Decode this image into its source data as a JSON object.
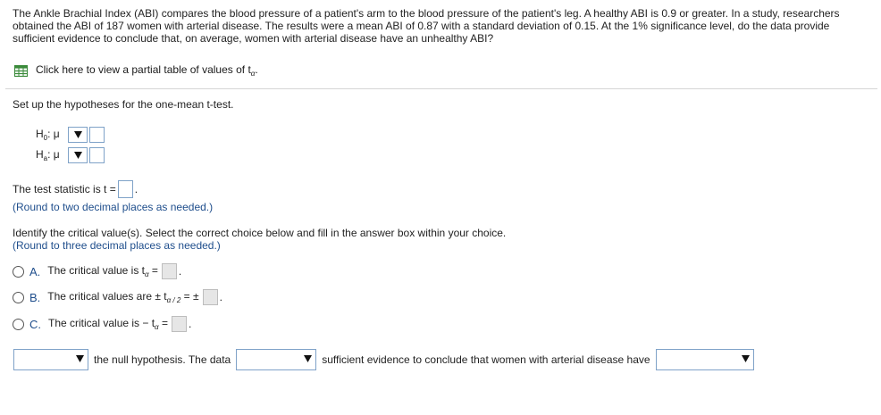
{
  "problem": {
    "text": "The Ankle Brachial Index (ABI) compares the blood pressure of a patient's arm to the blood pressure of the patient's leg. A healthy ABI is 0.9 or greater. In a study, researchers obtained the ABI of 187 women with arterial disease. The results were a mean ABI of 0.87 with a standard deviation of 0.15. At the 1% significance level, do the data provide sufficient evidence to conclude that, on average, women with arterial disease have an unhealthy ABI?"
  },
  "link": {
    "icon": "table-icon",
    "text": "Click here to view a partial table of values of t",
    "sub": "α",
    "end": "."
  },
  "setup": {
    "label": "Set up the hypotheses for the one-mean t-test."
  },
  "hypotheses": [
    {
      "symbol": "H",
      "sub": "0",
      "rest": ": μ"
    },
    {
      "symbol": "H",
      "sub": "a",
      "rest": ": μ"
    }
  ],
  "statistic": {
    "label": "The test statistic is t =",
    "end": ".",
    "note": "(Round to two decimal places as needed.)"
  },
  "critical": {
    "label": "Identify the critical value(s). Select the correct choice below and fill in the answer box within your choice.",
    "note": "(Round to three decimal places as needed.)",
    "choices": [
      {
        "letter": "A.",
        "pre": "The critical value is t",
        "sub": "α",
        "post": " ="
      },
      {
        "letter": "B.",
        "pre": "The critical values are ± t",
        "sub": "α / 2",
        "post": " = ±"
      },
      {
        "letter": "C.",
        "pre": "The critical value is  − t",
        "sub": "α",
        "post": " ="
      }
    ]
  },
  "sentence": {
    "part1": "the null hypothesis. The data",
    "part2": "sufficient evidence to conclude  that women with arterial disease have"
  },
  "colors": {
    "accent": "#1f4e8c",
    "border": "#7fa2c8",
    "disabled": "#e6e6e6"
  }
}
